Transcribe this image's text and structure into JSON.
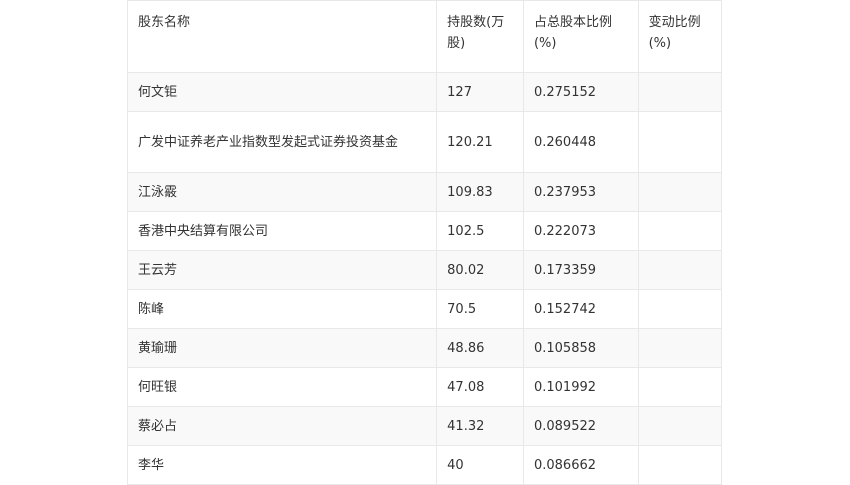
{
  "table": {
    "headers": [
      "股东名称",
      "持股数(万股)",
      "占总股本比例(%)",
      "变动比例(%)"
    ],
    "rows": [
      {
        "name": "何文钜",
        "shares": "127",
        "ratio": "0.275152",
        "change": ""
      },
      {
        "name": "广发中证养老产业指数型发起式证券投资基金",
        "shares": "120.21",
        "ratio": "0.260448",
        "change": ""
      },
      {
        "name": "江泳霰",
        "shares": "109.83",
        "ratio": "0.237953",
        "change": ""
      },
      {
        "name": "香港中央结算有限公司",
        "shares": "102.5",
        "ratio": "0.222073",
        "change": ""
      },
      {
        "name": "王云芳",
        "shares": "80.02",
        "ratio": "0.173359",
        "change": ""
      },
      {
        "name": "陈峰",
        "shares": "70.5",
        "ratio": "0.152742",
        "change": ""
      },
      {
        "name": "黄瑜珊",
        "shares": "48.86",
        "ratio": "0.105858",
        "change": ""
      },
      {
        "name": "何旺银",
        "shares": "47.08",
        "ratio": "0.101992",
        "change": ""
      },
      {
        "name": "蔡必占",
        "shares": "41.32",
        "ratio": "0.089522",
        "change": ""
      },
      {
        "name": "李华",
        "shares": "40",
        "ratio": "0.086662",
        "change": ""
      }
    ]
  }
}
